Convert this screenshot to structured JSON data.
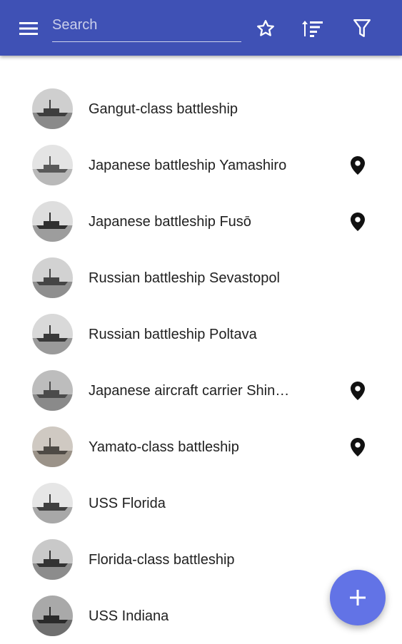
{
  "app_bar": {
    "search_placeholder": "Search",
    "search_value": "",
    "icons": [
      "menu-icon",
      "star-icon",
      "sort-icon",
      "filter-icon"
    ],
    "color": "#3f51b5"
  },
  "items": [
    {
      "title": "Gangut-class battleship",
      "has_location": false
    },
    {
      "title": "Japanese battleship Yamashiro",
      "has_location": true
    },
    {
      "title": "Japanese battleship Fusō",
      "has_location": true
    },
    {
      "title": "Russian battleship Sevastopol",
      "has_location": false
    },
    {
      "title": "Russian battleship Poltava",
      "has_location": false
    },
    {
      "title": "Japanese aircraft carrier Shin…",
      "has_location": true
    },
    {
      "title": "Yamato-class battleship",
      "has_location": true
    },
    {
      "title": "USS Florida",
      "has_location": false
    },
    {
      "title": "Florida-class battleship",
      "has_location": false
    },
    {
      "title": "USS Indiana",
      "has_location": false
    }
  ],
  "fab": {
    "icon": "plus-icon",
    "color": "#6273e6"
  }
}
